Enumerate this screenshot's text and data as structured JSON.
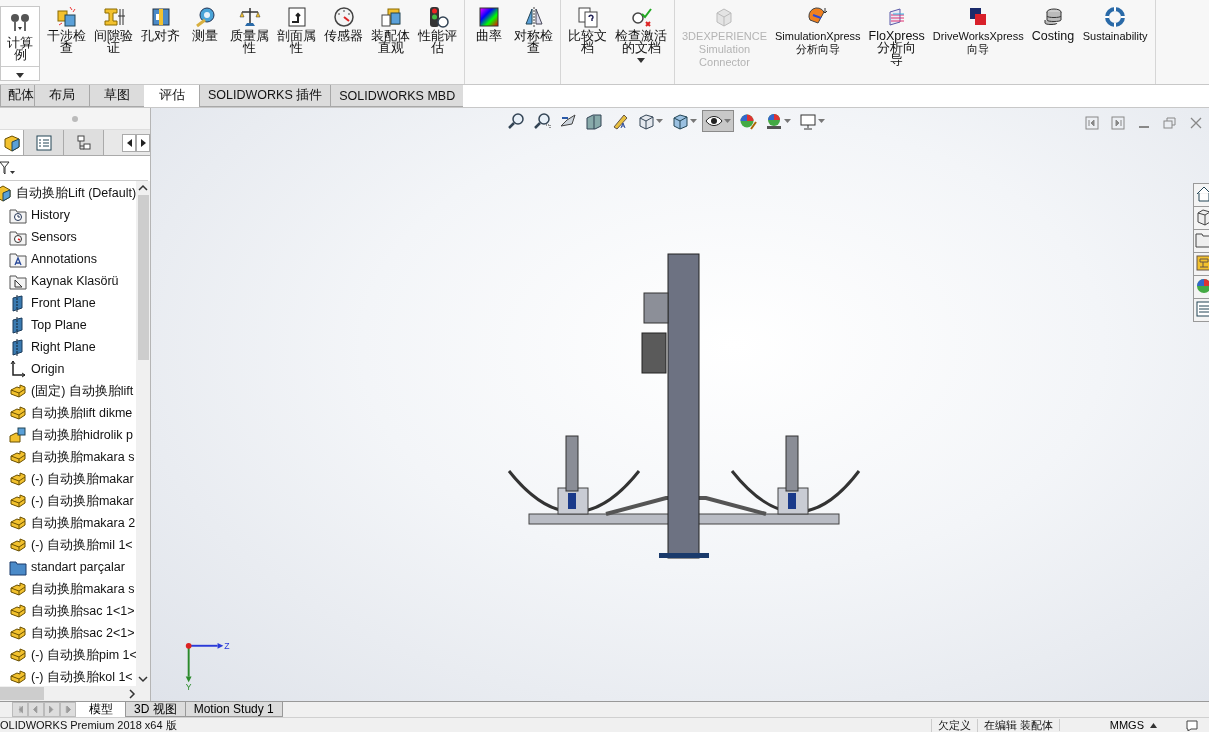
{
  "ribbon": {
    "groups": [
      [
        {
          "lines": [
            "计算",
            "例"
          ],
          "dropdown": true,
          "disabled": false
        }
      ],
      [
        {
          "lines": [
            "干涉检",
            "查"
          ],
          "dropdown": false,
          "disabled": false
        },
        {
          "lines": [
            "间隙验",
            "证"
          ],
          "dropdown": false,
          "disabled": false
        },
        {
          "lines": [
            "孔对齐"
          ],
          "dropdown": false,
          "disabled": false
        },
        {
          "lines": [
            "测量"
          ],
          "dropdown": false,
          "disabled": false
        },
        {
          "lines": [
            "质量属",
            "性"
          ],
          "dropdown": false,
          "disabled": false
        },
        {
          "lines": [
            "剖面属",
            "性"
          ],
          "dropdown": false,
          "disabled": false
        },
        {
          "lines": [
            "传感器"
          ],
          "dropdown": false,
          "disabled": false
        },
        {
          "lines": [
            "装配体",
            "直观"
          ],
          "dropdown": false,
          "disabled": false
        },
        {
          "lines": [
            "性能评",
            "估"
          ],
          "dropdown": false,
          "disabled": false
        }
      ],
      [
        {
          "lines": [
            "曲率"
          ],
          "dropdown": false,
          "disabled": false
        },
        {
          "lines": [
            "对称检",
            "查"
          ],
          "dropdown": false,
          "disabled": false
        }
      ],
      [
        {
          "lines": [
            "比较文",
            "档"
          ],
          "dropdown": false,
          "disabled": false
        },
        {
          "lines": [
            "检查激活",
            "的文档"
          ],
          "dropdown": true,
          "disabled": false
        }
      ],
      [
        {
          "lines": [
            "3DEXPERIENCE",
            "Simulation",
            "Connector"
          ],
          "dropdown": false,
          "disabled": true
        },
        {
          "lines": [
            "SimulationXpress",
            "分析向导"
          ],
          "dropdown": false,
          "disabled": false
        },
        {
          "lines": [
            "FloXpress",
            "分析向",
            "导"
          ],
          "dropdown": false,
          "disabled": false
        },
        {
          "lines": [
            "DriveWorksXpress",
            "向导"
          ],
          "dropdown": false,
          "disabled": false
        },
        {
          "lines": [
            "Costing"
          ],
          "dropdown": false,
          "disabled": false
        },
        {
          "lines": [
            "Sustainability"
          ],
          "dropdown": false,
          "disabled": false
        }
      ]
    ]
  },
  "tabs": [
    {
      "label": "配体",
      "selected": false
    },
    {
      "label": "布局",
      "selected": false
    },
    {
      "label": "草图",
      "selected": false
    },
    {
      "label": "评估",
      "selected": true
    },
    {
      "label": "SOLIDWORKS 插件",
      "selected": false
    },
    {
      "label": "SOLIDWORKS MBD",
      "selected": false
    }
  ],
  "heads_up_toolbar": [
    {
      "dropdown": false,
      "pressed": false
    },
    {
      "dropdown": false,
      "pressed": false
    },
    {
      "dropdown": false,
      "pressed": false
    },
    {
      "dropdown": false,
      "pressed": false
    },
    {
      "dropdown": false,
      "pressed": false
    },
    {
      "dropdown": true,
      "pressed": false
    },
    {
      "dropdown": true,
      "pressed": false
    },
    {
      "dropdown": true,
      "pressed": true
    },
    {
      "dropdown": false,
      "pressed": false
    },
    {
      "dropdown": true,
      "pressed": false
    },
    {
      "dropdown": true,
      "pressed": false
    }
  ],
  "panel_tabs": [
    {
      "selected": true
    },
    {
      "selected": false
    },
    {
      "selected": false
    }
  ],
  "feature_tree": {
    "label": "自动换胎Lift  (Default)",
    "kind": "assembly",
    "children": [
      {
        "label": "History",
        "kind": "history"
      },
      {
        "label": "Sensors",
        "kind": "sensors"
      },
      {
        "label": "Annotations",
        "kind": "annotations"
      },
      {
        "label": "Kaynak Klasörü",
        "kind": "weld"
      },
      {
        "label": "Front Plane",
        "kind": "plane"
      },
      {
        "label": "Top Plane",
        "kind": "plane"
      },
      {
        "label": "Right Plane",
        "kind": "plane"
      },
      {
        "label": "Origin",
        "kind": "origin"
      },
      {
        "label": "(固定) 自动换胎lift",
        "kind": "part"
      },
      {
        "label": "自动换胎lift dikme",
        "kind": "part"
      },
      {
        "label": "自动换胎hidrolik p",
        "kind": "subassembly"
      },
      {
        "label": "自动换胎makara s",
        "kind": "part"
      },
      {
        "label": "(-) 自动换胎makar",
        "kind": "part"
      },
      {
        "label": "(-) 自动换胎makar",
        "kind": "part"
      },
      {
        "label": "自动换胎makara 2",
        "kind": "part"
      },
      {
        "label": "(-) 自动换胎mil 1<",
        "kind": "part"
      },
      {
        "label": "standart parçalar",
        "kind": "folder"
      },
      {
        "label": "自动换胎makara s",
        "kind": "part"
      },
      {
        "label": "自动换胎sac 1<1>",
        "kind": "part"
      },
      {
        "label": "自动换胎sac 2<1>",
        "kind": "part"
      },
      {
        "label": "(-) 自动换胎pim 1<",
        "kind": "part"
      },
      {
        "label": "(-) 自动换胎kol 1<",
        "kind": "part"
      }
    ]
  },
  "triad": {
    "x_label": "Z",
    "y_label": "Y"
  },
  "bottom_tabs": [
    {
      "label": "模型",
      "selected": true
    },
    {
      "label": "3D 视图",
      "selected": false
    },
    {
      "label": "Motion Study 1",
      "selected": false
    }
  ],
  "status_bar": {
    "product": "OLIDWORKS Premium 2018 x64 版",
    "definition": "欠定义",
    "editing": "在编辑 装配体",
    "units": "MMGS"
  }
}
